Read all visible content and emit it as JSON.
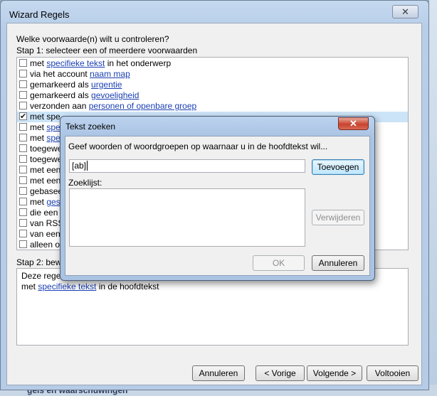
{
  "wizard": {
    "title": "Wizard Regels",
    "close_glyph": "✕",
    "question": "Welke voorwaarde(n) wilt u controleren?",
    "step1_label": "Stap 1: selecteer een of meerdere voorwaarden",
    "conditions": [
      {
        "pre": "met ",
        "link": "specifieke tekst",
        "post": " in het onderwerp",
        "checked": false
      },
      {
        "pre": "via het account ",
        "link": "naam map",
        "post": "",
        "checked": false
      },
      {
        "pre": "gemarkeerd als ",
        "link": "urgentie",
        "post": "",
        "checked": false
      },
      {
        "pre": "gemarkeerd als ",
        "link": "gevoeligheid",
        "post": "",
        "checked": false
      },
      {
        "pre": "verzonden aan ",
        "link": "personen of openbare groep",
        "post": "",
        "checked": false
      },
      {
        "pre": "met spe",
        "link": "",
        "post": "",
        "checked": true
      },
      {
        "pre": "met ",
        "link": "spec",
        "post": "",
        "checked": false
      },
      {
        "pre": "met ",
        "link": "spec",
        "post": "",
        "checked": false
      },
      {
        "pre": "toegewe",
        "link": "",
        "post": "",
        "checked": false
      },
      {
        "pre": "toegewe",
        "link": "",
        "post": "",
        "checked": false
      },
      {
        "pre": "met een",
        "link": "",
        "post": "",
        "checked": false
      },
      {
        "pre": "met een",
        "link": "",
        "post": "",
        "checked": false
      },
      {
        "pre": "gebasee",
        "link": "",
        "post": "",
        "checked": false
      },
      {
        "pre": "met ",
        "link": "gese",
        "post": "",
        "checked": false
      },
      {
        "pre": "die een",
        "link": "",
        "post": "",
        "checked": false
      },
      {
        "pre": "van RSS",
        "link": "",
        "post": "",
        "checked": false
      },
      {
        "pre": "van een",
        "link": "",
        "post": "",
        "checked": false
      },
      {
        "pre": "alleen op",
        "link": "",
        "post": "",
        "checked": false
      }
    ],
    "step2_label": "Stap 2: bewe",
    "description_line1": "Deze regel",
    "description_line2_pre": "met ",
    "description_line2_link": "specifieke tekst",
    "description_line2_post": " in de hoofdtekst",
    "buttons": {
      "cancel": "Annuleren",
      "back": "< Vorige",
      "next": "Volgende >",
      "finish": "Voltooien"
    }
  },
  "dialog": {
    "title": "Tekst zoeken",
    "close_glyph": "✕",
    "prompt": "Geef woorden of woordgroepen op waarnaar u in de hoofdtekst wil...",
    "input_value": "[ab]",
    "add_button": "Toevoegen",
    "list_label": "Zoeklijst:",
    "remove_button": "Verwijderen",
    "ok_button": "OK",
    "cancel_button": "Annuleren"
  },
  "background": {
    "bottom_text": "gels en waarschuwingen"
  }
}
